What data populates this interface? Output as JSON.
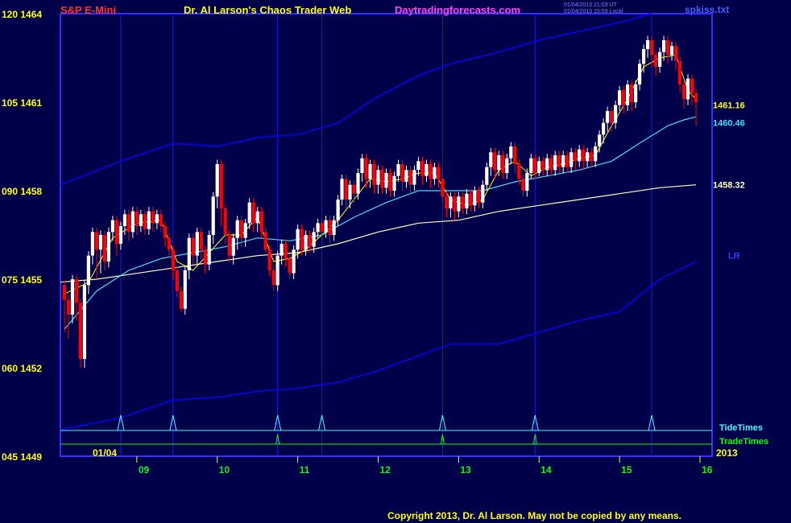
{
  "header": {
    "symbol": "S&P E-Mini",
    "title": "Dr. Al Larson's Chaos Trader Web",
    "site": "Daytradingforecasts.com",
    "stamp1": "01/04/2013 21:03 UT",
    "stamp2": "01/04/2013 15:03 Local",
    "file": "spkiss.txt"
  },
  "footer": {
    "copyright": "Copyright 2013, Dr. Al Larson. May not be copied by any means."
  },
  "colors": {
    "background": "#00004a",
    "frame": "#3030ff",
    "grid": "#1a1ae0",
    "up_bar": "#ffffff",
    "down_bar": "#ff0000",
    "ma_fast": "#ffff00",
    "ma_mid": "#40e0ff",
    "ma_slow": "#ffffc0",
    "band": "#0000ff",
    "tide": "#40ffff",
    "trade": "#00ff00"
  },
  "chart_data": {
    "type": "candlestick",
    "y_left_labels": [
      {
        "label": "120 1464",
        "value": 1464
      },
      {
        "label": "105 1461",
        "value": 1461
      },
      {
        "label": "090 1458",
        "value": 1458
      },
      {
        "label": "075 1455",
        "value": 1455
      },
      {
        "label": "060 1452",
        "value": 1452
      },
      {
        "label": "045 1449",
        "value": 1449
      }
    ],
    "ylim": [
      1449,
      1464
    ],
    "x_range": [
      8.05,
      16.15
    ],
    "x_ticks": [
      "09",
      "10",
      "11",
      "12",
      "13",
      "14",
      "15",
      "16"
    ],
    "date_label": "01/04",
    "year_label": "2013",
    "price_labels": [
      {
        "text": "1461.16",
        "value": 1460.9
      },
      {
        "text": "1460.46",
        "value": 1460.3
      },
      {
        "text": "1458.32",
        "value": 1458.2
      }
    ],
    "lr_label": "LR",
    "tide_label": "TideTimes",
    "trade_label": "TradeTimes",
    "tide_times": [
      8.8,
      9.45,
      10.75,
      11.3,
      12.8,
      13.95,
      15.4
    ],
    "trade_times": [
      10.75,
      12.8,
      13.95
    ],
    "vlines": [
      8.8,
      9.45,
      10.75,
      11.3,
      12.8,
      13.95,
      15.4
    ],
    "bars": [
      [
        8.1,
        1454.8,
        1454.3,
        1453.2
      ],
      [
        8.15,
        1454.3,
        1453.8,
        1453.0
      ],
      [
        8.2,
        1453.8,
        1455.0,
        1453.5
      ],
      [
        8.25,
        1455.0,
        1454.2,
        1453.6
      ],
      [
        8.3,
        1454.2,
        1452.3,
        1452.0
      ],
      [
        8.35,
        1452.3,
        1454.8,
        1452.0
      ],
      [
        8.4,
        1454.8,
        1455.8,
        1454.5
      ],
      [
        8.45,
        1455.8,
        1456.6,
        1455.5
      ],
      [
        8.5,
        1456.6,
        1456.0,
        1455.0
      ],
      [
        8.55,
        1456.0,
        1456.5,
        1455.2
      ],
      [
        8.6,
        1456.5,
        1455.6,
        1455.3
      ],
      [
        8.65,
        1455.6,
        1456.6,
        1455.4
      ],
      [
        8.7,
        1456.6,
        1457.0,
        1456.3
      ],
      [
        8.75,
        1457.0,
        1456.2,
        1455.8
      ],
      [
        8.8,
        1456.2,
        1456.8,
        1456.0
      ],
      [
        8.85,
        1456.8,
        1457.2,
        1456.5
      ],
      [
        8.9,
        1457.2,
        1456.6,
        1456.3
      ],
      [
        8.95,
        1456.6,
        1457.3,
        1456.4
      ],
      [
        9.0,
        1457.3,
        1456.8,
        1456.5
      ],
      [
        9.05,
        1456.8,
        1457.2,
        1456.6
      ],
      [
        9.1,
        1457.2,
        1456.7,
        1456.5
      ],
      [
        9.15,
        1456.7,
        1457.3,
        1456.5
      ],
      [
        9.2,
        1457.3,
        1456.9,
        1456.6
      ],
      [
        9.25,
        1456.9,
        1457.2,
        1456.7
      ],
      [
        9.3,
        1457.2,
        1456.8,
        1456.6
      ],
      [
        9.35,
        1456.8,
        1456.4,
        1456.1
      ],
      [
        9.4,
        1456.4,
        1456.0,
        1455.8
      ],
      [
        9.45,
        1456.0,
        1455.3,
        1455.0
      ],
      [
        9.5,
        1455.3,
        1454.6,
        1454.4
      ],
      [
        9.55,
        1454.6,
        1454.0,
        1453.9
      ],
      [
        9.6,
        1454.0,
        1455.3,
        1453.8
      ],
      [
        9.65,
        1455.3,
        1456.4,
        1455.0
      ],
      [
        9.7,
        1456.4,
        1455.8,
        1455.5
      ],
      [
        9.75,
        1455.8,
        1456.6,
        1455.5
      ],
      [
        9.8,
        1456.6,
        1456.0,
        1455.7
      ],
      [
        9.85,
        1456.0,
        1455.5,
        1455.2
      ],
      [
        9.9,
        1455.5,
        1456.5,
        1455.3
      ],
      [
        9.95,
        1456.5,
        1457.8,
        1456.2
      ],
      [
        10.0,
        1457.8,
        1458.9,
        1457.4
      ],
      [
        10.05,
        1458.9,
        1457.4,
        1456.8
      ],
      [
        10.1,
        1457.4,
        1456.5,
        1456.2
      ],
      [
        10.15,
        1456.5,
        1455.8,
        1455.6
      ],
      [
        10.2,
        1455.8,
        1456.4,
        1455.5
      ],
      [
        10.25,
        1456.4,
        1457.0,
        1456.0
      ],
      [
        10.3,
        1457.0,
        1456.4,
        1456.1
      ],
      [
        10.35,
        1456.4,
        1456.9,
        1456.1
      ],
      [
        10.4,
        1456.9,
        1457.6,
        1456.7
      ],
      [
        10.45,
        1457.6,
        1456.9,
        1456.6
      ],
      [
        10.5,
        1456.9,
        1457.3,
        1456.6
      ],
      [
        10.55,
        1457.3,
        1456.6,
        1456.4
      ],
      [
        10.6,
        1456.6,
        1456.0,
        1455.9
      ],
      [
        10.65,
        1456.0,
        1455.3,
        1455.1
      ],
      [
        10.7,
        1455.3,
        1454.8,
        1454.6
      ],
      [
        10.75,
        1454.8,
        1455.8,
        1454.6
      ],
      [
        10.8,
        1455.8,
        1456.2,
        1455.5
      ],
      [
        10.85,
        1456.2,
        1455.7,
        1455.4
      ],
      [
        10.9,
        1455.7,
        1455.2,
        1455.0
      ],
      [
        10.95,
        1455.2,
        1456.0,
        1455.0
      ],
      [
        11.0,
        1456.0,
        1456.7,
        1455.7
      ],
      [
        11.05,
        1456.7,
        1456.0,
        1455.8
      ],
      [
        11.1,
        1456.0,
        1456.5,
        1455.8
      ],
      [
        11.15,
        1456.5,
        1456.1,
        1455.9
      ],
      [
        11.2,
        1456.1,
        1456.6,
        1455.9
      ],
      [
        11.25,
        1456.6,
        1456.9,
        1456.4
      ],
      [
        11.3,
        1456.9,
        1456.6,
        1456.3
      ],
      [
        11.35,
        1456.6,
        1457.0,
        1456.4
      ],
      [
        11.4,
        1457.0,
        1456.5,
        1456.2
      ],
      [
        11.45,
        1456.5,
        1457.0,
        1456.3
      ],
      [
        11.5,
        1457.0,
        1457.7,
        1456.8
      ],
      [
        11.55,
        1457.7,
        1458.4,
        1457.5
      ],
      [
        11.6,
        1458.4,
        1457.7,
        1457.4
      ],
      [
        11.65,
        1457.7,
        1458.2,
        1457.4
      ],
      [
        11.7,
        1458.2,
        1457.9,
        1457.6
      ],
      [
        11.75,
        1457.9,
        1458.6,
        1457.7
      ],
      [
        11.8,
        1458.6,
        1459.1,
        1458.3
      ],
      [
        11.85,
        1459.1,
        1458.4,
        1458.1
      ],
      [
        11.9,
        1458.4,
        1458.9,
        1458.1
      ],
      [
        11.95,
        1458.9,
        1458.2,
        1457.9
      ],
      [
        12.0,
        1458.2,
        1458.7,
        1457.9
      ],
      [
        12.05,
        1458.7,
        1458.1,
        1457.9
      ],
      [
        12.1,
        1458.1,
        1458.6,
        1457.9
      ],
      [
        12.15,
        1458.6,
        1458.0,
        1457.8
      ],
      [
        12.2,
        1458.0,
        1458.5,
        1457.8
      ],
      [
        12.25,
        1458.5,
        1458.9,
        1458.3
      ],
      [
        12.3,
        1458.9,
        1458.3,
        1458.0
      ],
      [
        12.35,
        1458.3,
        1458.7,
        1458.1
      ],
      [
        12.4,
        1458.7,
        1458.2,
        1457.9
      ],
      [
        12.45,
        1458.2,
        1458.7,
        1458.0
      ],
      [
        12.5,
        1458.7,
        1459.0,
        1458.5
      ],
      [
        12.55,
        1459.0,
        1458.5,
        1458.2
      ],
      [
        12.6,
        1458.5,
        1458.9,
        1458.3
      ],
      [
        12.65,
        1458.9,
        1458.4,
        1458.1
      ],
      [
        12.7,
        1458.4,
        1458.8,
        1458.2
      ],
      [
        12.75,
        1458.8,
        1458.4,
        1458.1
      ],
      [
        12.8,
        1458.4,
        1457.8,
        1457.6
      ],
      [
        12.85,
        1457.8,
        1457.4,
        1457.1
      ],
      [
        12.9,
        1457.4,
        1457.8,
        1457.1
      ],
      [
        12.95,
        1457.8,
        1457.3,
        1457.0
      ],
      [
        13.0,
        1457.3,
        1457.8,
        1457.1
      ],
      [
        13.05,
        1457.8,
        1457.4,
        1457.2
      ],
      [
        13.1,
        1457.4,
        1457.9,
        1457.2
      ],
      [
        13.15,
        1457.9,
        1457.5,
        1457.3
      ],
      [
        13.2,
        1457.5,
        1458.0,
        1457.3
      ],
      [
        13.25,
        1458.0,
        1457.6,
        1457.4
      ],
      [
        13.3,
        1457.6,
        1458.2,
        1457.4
      ],
      [
        13.35,
        1458.2,
        1458.8,
        1458.0
      ],
      [
        13.4,
        1458.8,
        1459.3,
        1458.5
      ],
      [
        13.45,
        1459.3,
        1458.7,
        1458.4
      ],
      [
        13.5,
        1458.7,
        1459.2,
        1458.5
      ],
      [
        13.55,
        1459.2,
        1458.6,
        1458.4
      ],
      [
        13.6,
        1458.6,
        1459.1,
        1458.4
      ],
      [
        13.65,
        1459.1,
        1459.5,
        1458.9
      ],
      [
        13.7,
        1459.5,
        1458.9,
        1458.6
      ],
      [
        13.75,
        1458.9,
        1458.4,
        1458.2
      ],
      [
        13.8,
        1458.4,
        1458.0,
        1457.8
      ],
      [
        13.85,
        1458.0,
        1458.6,
        1457.8
      ],
      [
        13.9,
        1458.6,
        1459.1,
        1458.4
      ],
      [
        13.95,
        1459.1,
        1458.6,
        1458.4
      ],
      [
        14.0,
        1458.6,
        1459.0,
        1458.5
      ],
      [
        14.05,
        1459.0,
        1458.7,
        1458.5
      ],
      [
        14.1,
        1458.7,
        1459.1,
        1458.5
      ],
      [
        14.15,
        1459.1,
        1458.7,
        1458.5
      ],
      [
        14.2,
        1458.7,
        1459.2,
        1458.5
      ],
      [
        14.25,
        1459.2,
        1458.8,
        1458.6
      ],
      [
        14.3,
        1458.8,
        1459.2,
        1458.6
      ],
      [
        14.35,
        1459.2,
        1458.8,
        1458.6
      ],
      [
        14.4,
        1458.8,
        1459.3,
        1458.6
      ],
      [
        14.45,
        1459.3,
        1459.0,
        1458.7
      ],
      [
        14.5,
        1459.0,
        1459.4,
        1458.8
      ],
      [
        14.55,
        1459.4,
        1459.0,
        1458.7
      ],
      [
        14.6,
        1459.0,
        1459.3,
        1458.8
      ],
      [
        14.65,
        1459.3,
        1459.0,
        1458.8
      ],
      [
        14.7,
        1459.0,
        1459.5,
        1458.8
      ],
      [
        14.75,
        1459.5,
        1459.9,
        1459.3
      ],
      [
        14.8,
        1459.9,
        1460.3,
        1459.6
      ],
      [
        14.85,
        1460.3,
        1460.7,
        1460.0
      ],
      [
        14.9,
        1460.7,
        1460.3,
        1460.0
      ],
      [
        14.95,
        1460.3,
        1460.9,
        1460.1
      ],
      [
        15.0,
        1460.9,
        1461.4,
        1460.7
      ],
      [
        15.05,
        1461.4,
        1460.9,
        1460.6
      ],
      [
        15.1,
        1460.9,
        1461.6,
        1460.7
      ],
      [
        15.15,
        1461.6,
        1461.0,
        1460.7
      ],
      [
        15.2,
        1461.0,
        1461.6,
        1460.8
      ],
      [
        15.25,
        1461.6,
        1462.3,
        1461.4
      ],
      [
        15.3,
        1462.3,
        1462.8,
        1462.0
      ],
      [
        15.35,
        1462.8,
        1463.1,
        1462.5
      ],
      [
        15.4,
        1463.1,
        1462.6,
        1462.2
      ],
      [
        15.45,
        1462.6,
        1462.2,
        1461.9
      ],
      [
        15.5,
        1462.2,
        1462.7,
        1462.0
      ],
      [
        15.55,
        1462.7,
        1463.1,
        1462.4
      ],
      [
        15.6,
        1463.1,
        1462.6,
        1462.3
      ],
      [
        15.65,
        1462.6,
        1462.9,
        1462.4
      ],
      [
        15.7,
        1462.9,
        1462.4,
        1462.1
      ],
      [
        15.75,
        1462.4,
        1461.6,
        1461.3
      ],
      [
        15.8,
        1461.6,
        1461.1,
        1460.8
      ],
      [
        15.85,
        1461.1,
        1461.8,
        1460.9
      ],
      [
        15.9,
        1461.8,
        1461.3,
        1460.9
      ],
      [
        15.95,
        1461.3,
        1461.0,
        1460.2
      ]
    ],
    "ma_fast": [
      [
        8.1,
        1454.5
      ],
      [
        8.4,
        1454.9
      ],
      [
        8.7,
        1456.4
      ],
      [
        9.0,
        1456.9
      ],
      [
        9.3,
        1457.0
      ],
      [
        9.5,
        1455.6
      ],
      [
        9.7,
        1455.3
      ],
      [
        9.9,
        1455.9
      ],
      [
        10.1,
        1456.5
      ],
      [
        10.3,
        1456.5
      ],
      [
        10.5,
        1457.1
      ],
      [
        10.7,
        1455.6
      ],
      [
        10.9,
        1455.7
      ],
      [
        11.1,
        1456.0
      ],
      [
        11.3,
        1456.5
      ],
      [
        11.5,
        1457.0
      ],
      [
        11.7,
        1457.7
      ],
      [
        11.9,
        1458.4
      ],
      [
        12.1,
        1458.3
      ],
      [
        12.3,
        1458.4
      ],
      [
        12.5,
        1458.6
      ],
      [
        12.7,
        1458.6
      ],
      [
        12.9,
        1457.7
      ],
      [
        13.1,
        1457.5
      ],
      [
        13.3,
        1457.7
      ],
      [
        13.5,
        1458.7
      ],
      [
        13.7,
        1459.0
      ],
      [
        13.9,
        1458.5
      ],
      [
        14.1,
        1458.8
      ],
      [
        14.3,
        1458.9
      ],
      [
        14.5,
        1459.1
      ],
      [
        14.7,
        1459.2
      ],
      [
        14.9,
        1460.2
      ],
      [
        15.1,
        1461.1
      ],
      [
        15.3,
        1462.2
      ],
      [
        15.5,
        1462.5
      ],
      [
        15.7,
        1462.6
      ],
      [
        15.85,
        1461.4
      ],
      [
        15.95,
        1461.1
      ]
    ],
    "ma_mid": [
      [
        8.1,
        1453.3
      ],
      [
        8.5,
        1454.6
      ],
      [
        8.9,
        1455.3
      ],
      [
        9.3,
        1455.7
      ],
      [
        9.7,
        1455.9
      ],
      [
        10.1,
        1456.1
      ],
      [
        10.5,
        1456.4
      ],
      [
        10.9,
        1456.3
      ],
      [
        11.3,
        1456.5
      ],
      [
        11.7,
        1457.1
      ],
      [
        12.1,
        1457.6
      ],
      [
        12.5,
        1458.0
      ],
      [
        12.9,
        1458.0
      ],
      [
        13.3,
        1458.0
      ],
      [
        13.7,
        1458.3
      ],
      [
        14.1,
        1458.5
      ],
      [
        14.5,
        1458.7
      ],
      [
        14.9,
        1459.0
      ],
      [
        15.3,
        1459.7
      ],
      [
        15.6,
        1460.2
      ],
      [
        15.8,
        1460.4
      ],
      [
        15.95,
        1460.5
      ]
    ],
    "ma_slow": [
      [
        8.05,
        1454.9
      ],
      [
        8.5,
        1455.0
      ],
      [
        9.0,
        1455.2
      ],
      [
        9.5,
        1455.4
      ],
      [
        10.0,
        1455.6
      ],
      [
        10.5,
        1455.8
      ],
      [
        11.0,
        1455.9
      ],
      [
        11.5,
        1456.2
      ],
      [
        12.0,
        1456.6
      ],
      [
        12.5,
        1456.9
      ],
      [
        13.0,
        1457.0
      ],
      [
        13.5,
        1457.3
      ],
      [
        14.0,
        1457.5
      ],
      [
        14.5,
        1457.7
      ],
      [
        15.0,
        1457.9
      ],
      [
        15.5,
        1458.1
      ],
      [
        15.95,
        1458.2
      ]
    ],
    "band_upper": [
      [
        8.05,
        1458.2
      ],
      [
        8.8,
        1459.0
      ],
      [
        9.45,
        1459.6
      ],
      [
        10.0,
        1459.5
      ],
      [
        10.5,
        1459.8
      ],
      [
        11.0,
        1459.9
      ],
      [
        11.5,
        1460.3
      ],
      [
        12.0,
        1461.2
      ],
      [
        12.5,
        1461.9
      ],
      [
        12.9,
        1462.3
      ],
      [
        13.5,
        1462.7
      ],
      [
        14.0,
        1463.1
      ],
      [
        14.5,
        1463.4
      ],
      [
        15.0,
        1463.7
      ],
      [
        15.4,
        1464.0
      ]
    ],
    "band_lower": [
      [
        8.05,
        1449.9
      ],
      [
        8.8,
        1450.3
      ],
      [
        9.45,
        1450.9
      ],
      [
        10.0,
        1451.0
      ],
      [
        10.5,
        1451.2
      ],
      [
        11.0,
        1451.3
      ],
      [
        11.5,
        1451.5
      ],
      [
        12.0,
        1451.9
      ],
      [
        12.5,
        1452.4
      ],
      [
        12.9,
        1452.8
      ],
      [
        13.5,
        1452.8
      ],
      [
        14.0,
        1453.2
      ],
      [
        14.5,
        1453.6
      ],
      [
        15.0,
        1453.9
      ],
      [
        15.5,
        1455.0
      ],
      [
        15.95,
        1455.6
      ]
    ]
  }
}
